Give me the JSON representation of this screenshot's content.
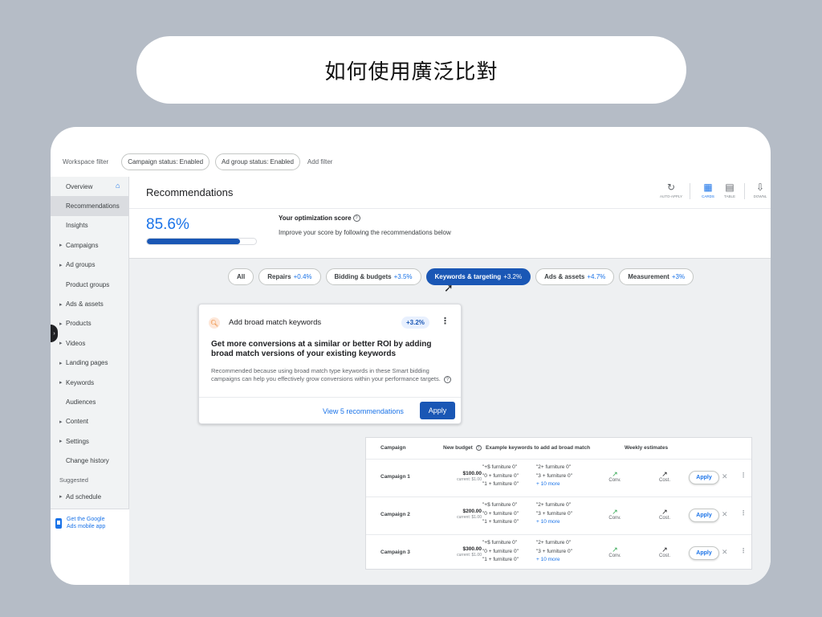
{
  "banner": {
    "title": "如何使用廣泛比對"
  },
  "filterbar": {
    "label": "Workspace filter",
    "chips": [
      "Campaign status: Enabled",
      "Ad group status: Enabled"
    ],
    "add_filter": "Add filter"
  },
  "sidebar": {
    "items": [
      {
        "label": "Overview"
      },
      {
        "label": "Recommendations"
      },
      {
        "label": "Insights"
      },
      {
        "label": "Campaigns"
      },
      {
        "label": "Ad groups"
      },
      {
        "label": "Product groups"
      },
      {
        "label": "Ads & assets"
      },
      {
        "label": "Products"
      },
      {
        "label": "Videos"
      },
      {
        "label": "Landing pages"
      },
      {
        "label": "Keywords"
      },
      {
        "label": "Audiences"
      },
      {
        "label": "Content"
      },
      {
        "label": "Settings"
      },
      {
        "label": "Change history"
      }
    ],
    "suggested_label": "Suggested",
    "suggested_items": [
      {
        "label": "Ad schedule"
      }
    ],
    "app_line1": "Get the Google",
    "app_line2": "Ads mobile app"
  },
  "header": {
    "title": "Recommendations",
    "auto_apply": "AUTO-APPLY",
    "cards": "CARDS",
    "table": "TABLE",
    "download": "DOWNL"
  },
  "score": {
    "value": "85.6%",
    "fraction": 0.856,
    "label": "Your optimization score",
    "subtitle": "Improve your score by following the recommendations below"
  },
  "tabs": [
    {
      "label": "All",
      "delta": ""
    },
    {
      "label": "Repairs",
      "delta": "+0.4%"
    },
    {
      "label": "Bidding & budgets",
      "delta": "+3.5%"
    },
    {
      "label": "Keywords & targeting",
      "delta": "+3.2%"
    },
    {
      "label": "Ads & assets",
      "delta": "+4.7%"
    },
    {
      "label": "Measurement",
      "delta": "+3%"
    }
  ],
  "rec_card": {
    "title": "Add broad match keywords",
    "badge": "+3.2%",
    "headline": "Get more conversions at a similar or better ROI by adding broad match versions of your existing keywords",
    "body": "Recommended because using broad match type keywords in these Smart bidding campaigns can help you effectively grow conversions within your performance targets.",
    "view_label": "View 5 recommendations",
    "apply_label": "Apply"
  },
  "table": {
    "headers": {
      "campaign": "Campaign",
      "budget": "New budget",
      "keywords": "Example keywords to add ad broad match",
      "weekly": "Weekly estimates"
    },
    "rows": [
      {
        "name": "Campaign 1",
        "budget": "$100.00",
        "current": "current: $1.00",
        "kw1": [
          "\"+$ furniture 0\"",
          "\"0 + furniture 0\"",
          "\"1 + furniture 0\""
        ],
        "kw2": [
          "\"2+ furniture 0\"",
          "\"3 + furniture 0\""
        ],
        "more": "+ 10 more",
        "conv": "Conv.",
        "cost": "Cost.",
        "apply": "Apply"
      },
      {
        "name": "Campaign 2",
        "budget": "$200.00",
        "current": "current: $1.00",
        "kw1": [
          "\"+$ furniture 0\"",
          "\"0 + furniture 0\"",
          "\"1 + furniture 0\""
        ],
        "kw2": [
          "\"2+ furniture 0\"",
          "\"3 + furniture 0\""
        ],
        "more": "+ 10 more",
        "conv": "Conv.",
        "cost": "Cost.",
        "apply": "Apply"
      },
      {
        "name": "Campaign 3",
        "budget": "$300.00",
        "current": "current: $1.00",
        "kw1": [
          "\"+$ furniture 0\"",
          "\"0 + furniture 0\"",
          "\"1 + furniture 0\""
        ],
        "kw2": [
          "\"2+ furniture 0\"",
          "\"3 + furniture 0\""
        ],
        "more": "+ 10 more",
        "conv": "Conv.",
        "cost": "Cost.",
        "apply": "Apply"
      }
    ]
  }
}
